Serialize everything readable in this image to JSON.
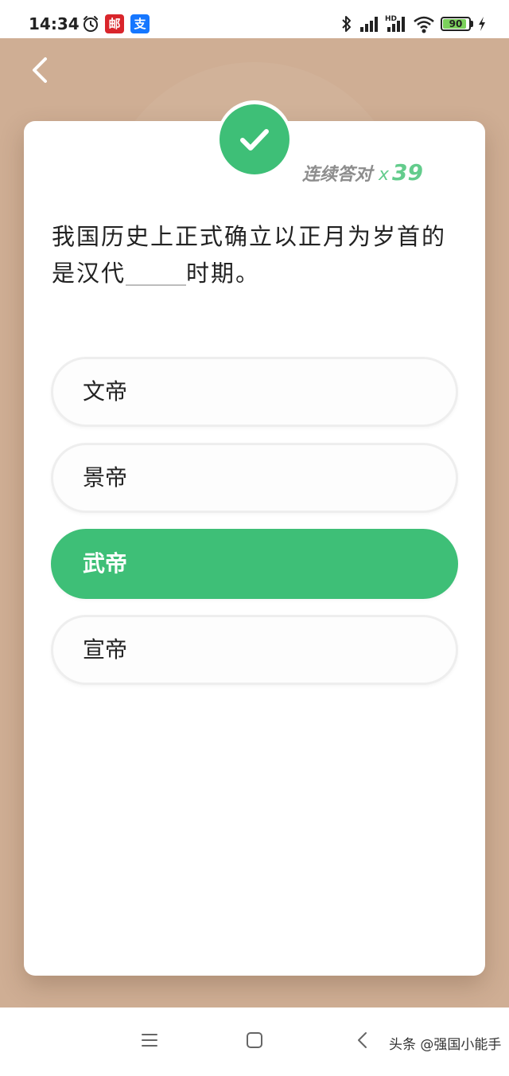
{
  "status_bar": {
    "time": "14:34",
    "battery_percent": 90,
    "battery_label": "90",
    "network_hd_label": "HD",
    "app_icons": [
      "alarm-icon",
      "postal-app-icon",
      "alipay-app-icon"
    ],
    "postal_glyph": "邮",
    "alipay_glyph": "支"
  },
  "header": {
    "back_icon": "chevron-left-icon"
  },
  "result": {
    "icon": "check-icon",
    "streak_label": "连续答对",
    "streak_multiplier": "x",
    "streak_count": "39"
  },
  "question": {
    "text_before": "我国历史上正式确立以正月为岁首的是汉代",
    "text_after": "时期。"
  },
  "options": [
    {
      "label": "文帝",
      "selected": false
    },
    {
      "label": "景帝",
      "selected": false
    },
    {
      "label": "武帝",
      "selected": true
    },
    {
      "label": "宣帝",
      "selected": false
    }
  ],
  "nav_bar": {
    "icons": [
      "menu-icon",
      "home-icon",
      "back-icon"
    ],
    "watermark": "头条 @强国小能手"
  },
  "colors": {
    "background": "#cfae94",
    "accent": "#3ebf77",
    "streak_accent": "#63cc8c",
    "card": "#ffffff"
  }
}
